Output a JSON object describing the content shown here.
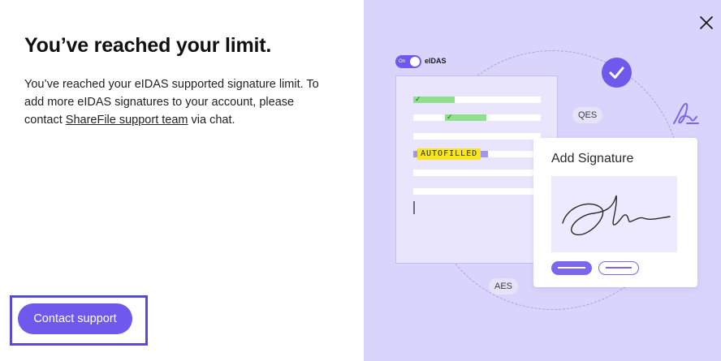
{
  "dialog": {
    "title": "You’ve reached your limit.",
    "body_before_link": "You’ve reached your eIDAS supported signature limit. To add more eIDAS signatures to your account, please contact ",
    "link_text": "ShareFile support team",
    "body_after_link": " via chat.",
    "contact_button_label": "Contact support",
    "close_icon": "close-icon"
  },
  "illustration": {
    "toggle_state": "On",
    "toggle_label": "eIDAS",
    "autofilled_label": "AUTOFILLED",
    "pill_qes": "QES",
    "pill_aes": "AES",
    "card_title": "Add Signature",
    "icons": [
      "check-circle-icon",
      "signature-icon",
      "close-icon"
    ]
  },
  "colors": {
    "accent": "#6e59ec",
    "illustration_bg": "#d9d4fb",
    "highlight_green": "#8fe08a",
    "autofilled_yellow": "#f8e51c"
  }
}
